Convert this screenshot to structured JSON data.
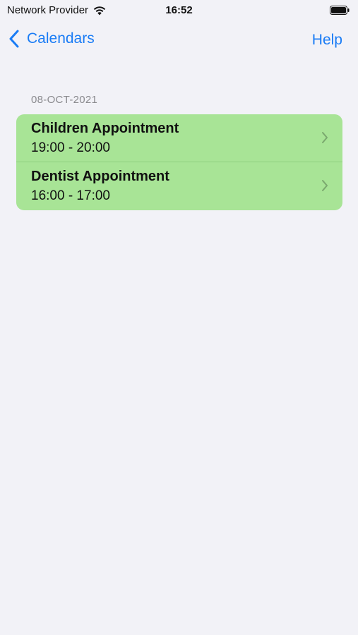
{
  "status_bar": {
    "carrier": "Network Provider",
    "time": "16:52",
    "wifi_icon": "wifi-icon",
    "battery_icon": "battery-icon"
  },
  "nav": {
    "back_label": "Calendars",
    "help_label": "Help",
    "accent_color": "#1a7cf5"
  },
  "section": {
    "date": "08-OCT-2021",
    "row_color": "#a8e496",
    "items": [
      {
        "title": "Children Appointment",
        "time": "19:00 - 20:00"
      },
      {
        "title": "Dentist Appointment",
        "time": "16:00 - 17:00"
      }
    ]
  }
}
